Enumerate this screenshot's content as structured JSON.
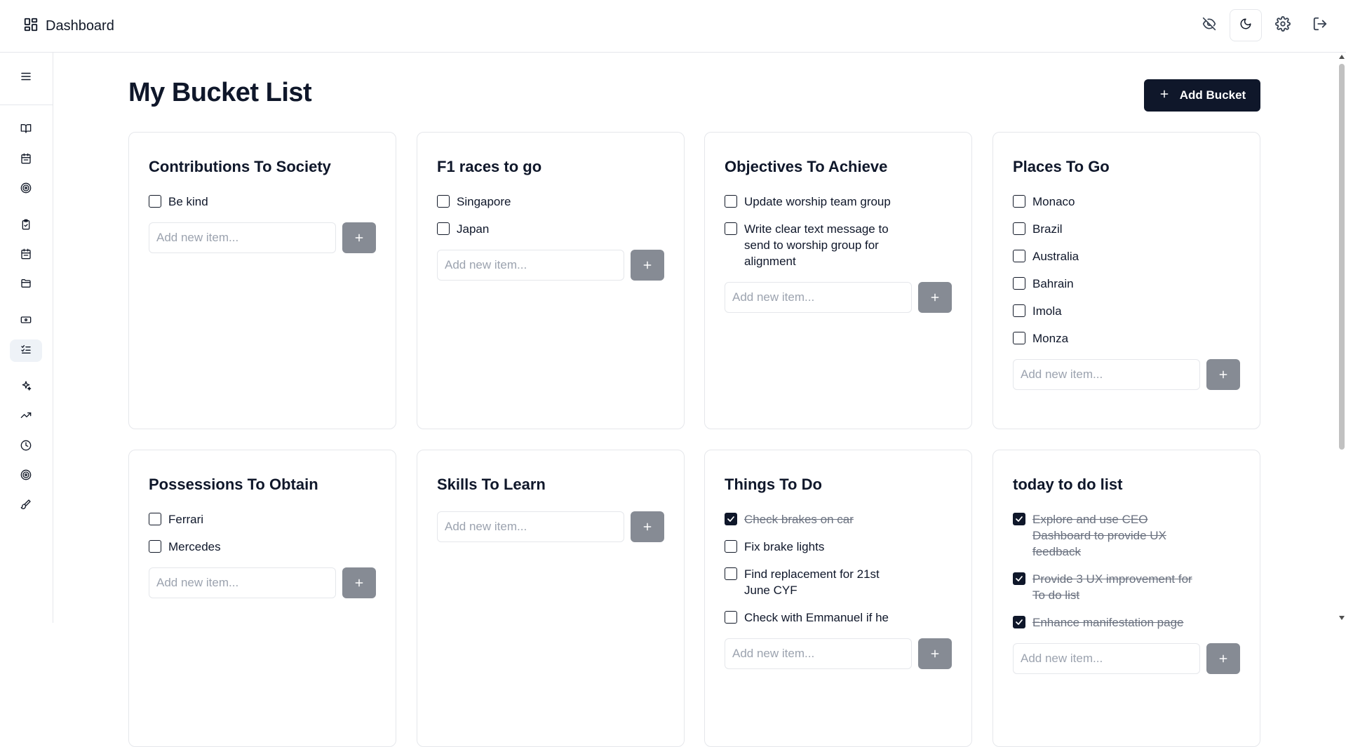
{
  "app": {
    "title": "Dashboard"
  },
  "page": {
    "title": "My Bucket List",
    "add_bucket_label": "Add Bucket"
  },
  "topbar_icons": [
    "eye-off-icon",
    "moon-icon",
    "settings-icon",
    "logout-icon"
  ],
  "sidebar_icons": [
    "menu-icon",
    "book-icon",
    "calendar-icon",
    "target-icon",
    "clipboard-icon",
    "calendar-icon",
    "folder-icon",
    "money-icon",
    "list-check-icon",
    "sparkles-icon",
    "trending-up-icon",
    "clock-icon",
    "target-icon",
    "brush-icon"
  ],
  "colors": {
    "primary": "#0f172a",
    "add_button": "#868b94",
    "border": "#e5e7eb",
    "done_text": "#6b7280"
  },
  "buckets": [
    {
      "title": "Contributions To Society",
      "placeholder": "Add new item...",
      "items": [
        {
          "text": "Be kind",
          "done": false
        }
      ]
    },
    {
      "title": "F1 races to go",
      "placeholder": "Add new item...",
      "items": [
        {
          "text": "Singapore",
          "done": false
        },
        {
          "text": "Japan",
          "done": false
        }
      ]
    },
    {
      "title": "Objectives To Achieve",
      "placeholder": "Add new item...",
      "items": [
        {
          "text": "Update worship team group",
          "done": false
        },
        {
          "text": "Write clear text message to send to worship group for alignment",
          "done": false
        }
      ]
    },
    {
      "title": "Places To Go",
      "placeholder": "Add new item...",
      "items": [
        {
          "text": "Monaco",
          "done": false
        },
        {
          "text": "Brazil",
          "done": false
        },
        {
          "text": "Australia",
          "done": false
        },
        {
          "text": "Bahrain",
          "done": false
        },
        {
          "text": "Imola",
          "done": false
        },
        {
          "text": "Monza",
          "done": false
        }
      ]
    },
    {
      "title": "Possessions To Obtain",
      "placeholder": "Add new item...",
      "items": [
        {
          "text": "Ferrari",
          "done": false
        },
        {
          "text": "Mercedes",
          "done": false
        }
      ]
    },
    {
      "title": "Skills To Learn",
      "placeholder": "Add new item...",
      "items": []
    },
    {
      "title": "Things To Do",
      "placeholder": "Add new item...",
      "items": [
        {
          "text": "Check brakes on car",
          "done": true
        },
        {
          "text": "Fix brake lights",
          "done": false
        },
        {
          "text": "Find replacement for 21st June CYF",
          "done": false
        },
        {
          "text": "Check with Emmanuel if he",
          "done": false
        }
      ]
    },
    {
      "title": "today to do list",
      "placeholder": "Add new item...",
      "items": [
        {
          "text": "Explore and use CEO Dashboard to provide UX feedback",
          "done": true
        },
        {
          "text": "Provide 3 UX improvement for To do list",
          "done": true
        },
        {
          "text": "Enhance manifestation page",
          "done": true
        }
      ]
    }
  ]
}
